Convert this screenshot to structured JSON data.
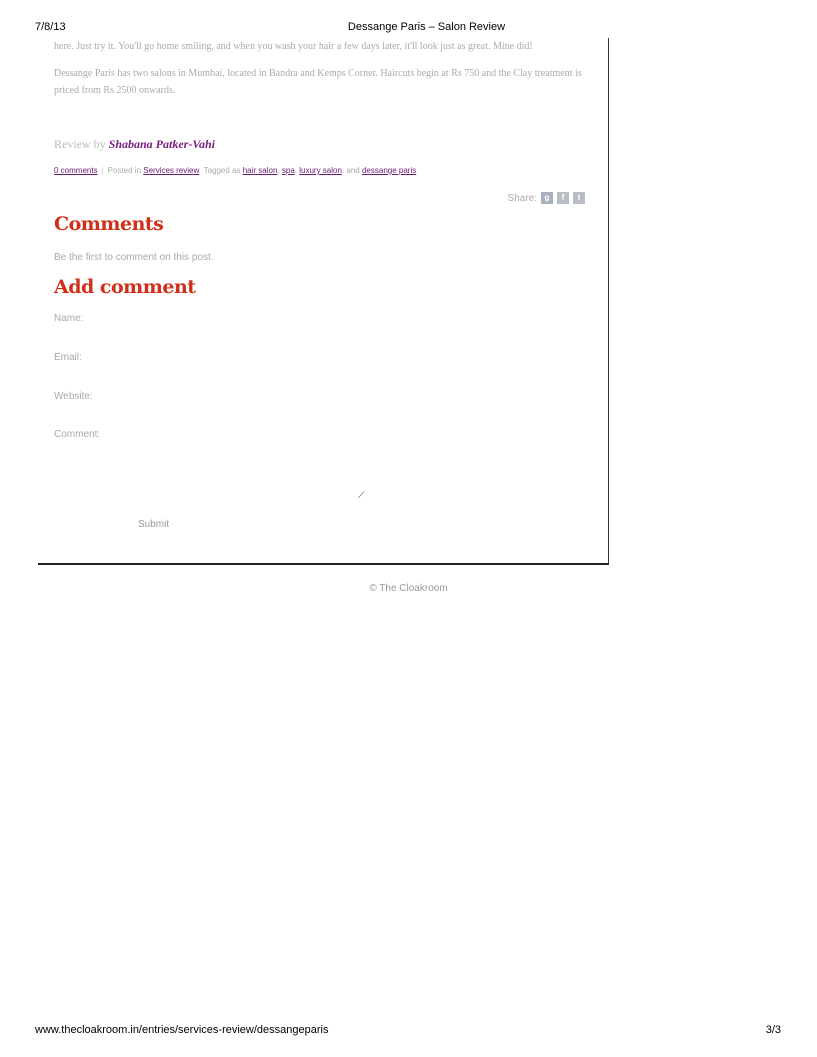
{
  "print_header": {
    "date": "7/8/13",
    "title": "Dessange Paris – Salon Review"
  },
  "print_footer": {
    "url": "www.thecloakroom.in/entries/services-review/dessangeparis",
    "page": "3/3"
  },
  "article": {
    "paragraph_1": "here. Just try it. You'll go home smiling, and when you wash your hair a few days later, it'll look just as great. Mine did!",
    "paragraph_2": "Dessange Paris has two salons in Mumbai, located in Bandra and Kemps Corner. Haircuts begin at Rs 750 and the Clay treatment is priced from Rs 2500 onwards.",
    "review_prefix": "Review by",
    "author": "Shabana Patker-Vahi"
  },
  "meta": {
    "comments_link": "0 comments",
    "separator": "|",
    "posted_in": "Posted in",
    "category": "Services review",
    "tagged_as": "Tagged as",
    "tags": [
      "hair salon",
      "spa",
      "luxury salon",
      "dessange paris"
    ],
    "and": "and"
  },
  "share": {
    "label": "Share:",
    "icons": [
      "google-icon",
      "facebook-icon",
      "twitter-icon"
    ]
  },
  "comments": {
    "heading": "Comments",
    "empty_text": "Be the first to comment on this post."
  },
  "add_comment": {
    "heading": "Add comment",
    "name_label": "Name:",
    "email_label": "Email:",
    "website_label": "Website:",
    "comment_label": "Comment:",
    "submit_label": "Submit"
  },
  "footer": {
    "copyright": "© The Cloakroom"
  },
  "colors": {
    "heading_red": "#d0301a",
    "link_purple": "#6a1b73",
    "author_purple": "#7a1f82",
    "muted_text": "#aaaaaa"
  }
}
